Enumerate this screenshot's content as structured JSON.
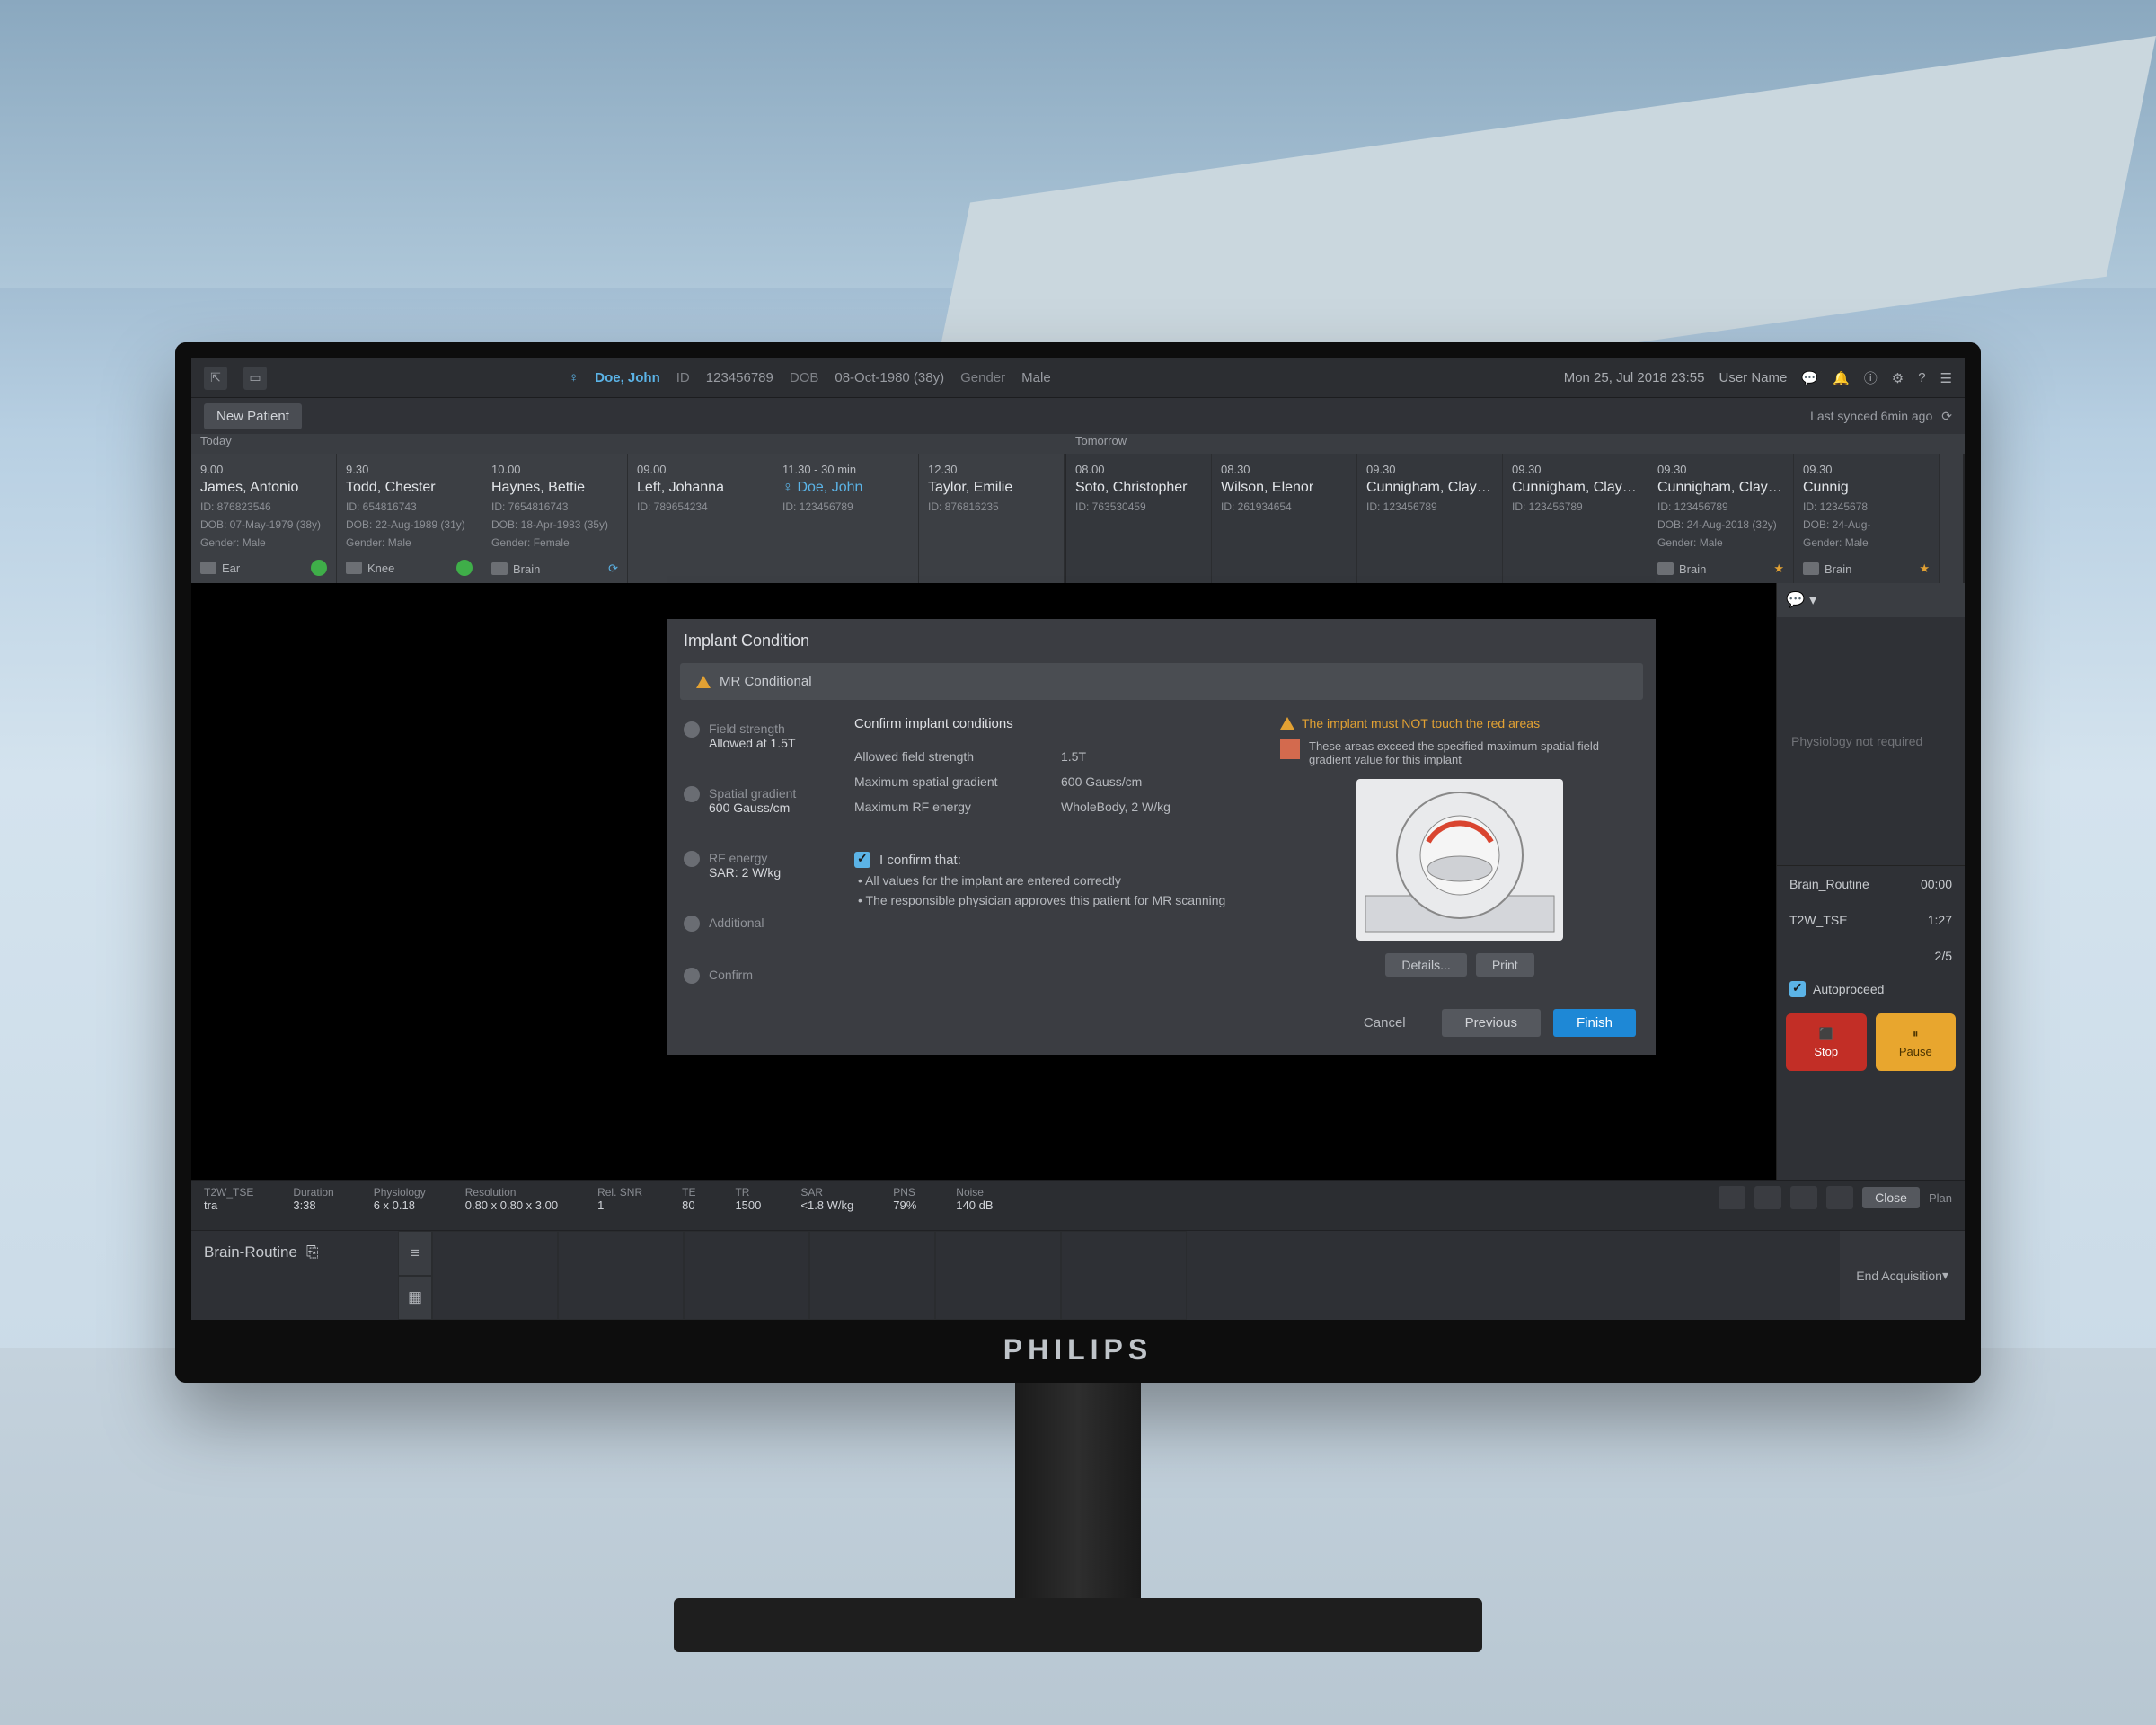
{
  "header": {
    "patient_name": "Doe, John",
    "id_label": "ID",
    "id_value": "123456789",
    "dob_label": "DOB",
    "dob_value": "08-Oct-1980 (38y)",
    "gender_label": "Gender",
    "gender_value": "Male",
    "date_time": "Mon 25, Jul 2018  23:55",
    "user": "User Name"
  },
  "toolbar": {
    "new_patient": "New Patient",
    "last_sync": "Last synced 6min ago"
  },
  "schedule": {
    "today_label": "Today",
    "tomorrow_label": "Tomorrow",
    "today": [
      {
        "time": "9.00",
        "name": "James, Antonio",
        "id": "ID: 876823546",
        "dob": "DOB: 07-May-1979 (38y)",
        "gender": "Gender: Male",
        "region": "Ear",
        "status": "done"
      },
      {
        "time": "9.30",
        "name": "Todd, Chester",
        "id": "ID: 654816743",
        "dob": "DOB: 22-Aug-1989 (31y)",
        "gender": "Gender: Male",
        "region": "Knee",
        "status": "done"
      },
      {
        "time": "10.00",
        "name": "Haynes, Bettie",
        "id": "ID: 7654816743",
        "dob": "DOB: 18-Apr-1983 (35y)",
        "gender": "Gender: Female",
        "region": "Brain",
        "status": "sync"
      },
      {
        "time": "09.00",
        "name": "Left, Johanna",
        "id": "ID: 789654234",
        "dob": "",
        "gender": "",
        "region": "",
        "status": ""
      },
      {
        "time": "11.30 - 30 min",
        "name": "Doe, John",
        "id": "ID: 123456789",
        "dob": "",
        "gender": "",
        "region": "",
        "status": "active"
      },
      {
        "time": "12.30",
        "name": "Taylor, Emilie",
        "id": "ID: 876816235",
        "dob": "",
        "gender": "",
        "region": "",
        "status": ""
      }
    ],
    "tomorrow": [
      {
        "time": "08.00",
        "name": "Soto, Christopher",
        "id": "ID: 763530459",
        "dob": "",
        "gender": "",
        "region": "",
        "status": ""
      },
      {
        "time": "08.30",
        "name": "Wilson, Elenor",
        "id": "ID: 261934654",
        "dob": "",
        "gender": "",
        "region": "",
        "status": ""
      },
      {
        "time": "09.30",
        "name": "Cunnigham, Clayton",
        "id": "ID: 123456789",
        "dob": "",
        "gender": "",
        "region": "",
        "status": ""
      },
      {
        "time": "09.30",
        "name": "Cunnigham, Clayton",
        "id": "ID: 123456789",
        "dob": "",
        "gender": "",
        "region": "",
        "status": ""
      },
      {
        "time": "09.30",
        "name": "Cunnigham, Clayton",
        "id": "ID: 123456789",
        "dob": "DOB: 24-Aug-2018 (32y)",
        "gender": "Gender: Male",
        "region": "Brain",
        "status": "star"
      },
      {
        "time": "09.30",
        "name": "Cunnig",
        "id": "ID: 12345678",
        "dob": "DOB: 24-Aug-",
        "gender": "Gender: Male",
        "region": "Brain",
        "status": "star"
      }
    ]
  },
  "params": {
    "seq": {
      "l": "T2W_TSE",
      "v": "tra"
    },
    "duration": {
      "l": "Duration",
      "v": "3:38"
    },
    "physiology": {
      "l": "Physiology",
      "v": "6 x 0.18"
    },
    "resolution": {
      "l": "Resolution",
      "v": "0.80 x 0.80 x 3.00"
    },
    "relsnr": {
      "l": "Rel. SNR",
      "v": "1"
    },
    "te": {
      "l": "TE",
      "v": "80"
    },
    "tr": {
      "l": "TR",
      "v": "1500"
    },
    "sar": {
      "l": "SAR",
      "v": "<1.8 W/kg"
    },
    "pns": {
      "l": "PNS",
      "v": "79%"
    },
    "noise": {
      "l": "Noise",
      "v": "140 dB"
    },
    "close": "Close",
    "plan": "Plan"
  },
  "footer": {
    "protocol": "Brain-Routine",
    "end_acq": "End Acquisition"
  },
  "rail": {
    "phys": "Physiology not required",
    "seq_name": "Brain_Routine",
    "seq_time": "00:00",
    "seq2_name": "T2W_TSE",
    "seq2_time": "1:27",
    "count": "2/5",
    "auto": "Autoproceed",
    "stop": "Stop",
    "pause": "Pause"
  },
  "dialog": {
    "title": "Implant Condition",
    "badge": "MR Conditional",
    "steps": [
      {
        "t": "Field strength",
        "v": "Allowed at 1.5T"
      },
      {
        "t": "Spatial gradient",
        "v": "600 Gauss/cm"
      },
      {
        "t": "RF energy",
        "v": "SAR: 2 W/kg"
      },
      {
        "t": "Additional",
        "v": ""
      },
      {
        "t": "Confirm",
        "v": ""
      }
    ],
    "heading": "Confirm implant conditions",
    "rows": [
      {
        "k": "Allowed field strength",
        "v": "1.5T"
      },
      {
        "k": "Maximum spatial gradient",
        "v": "600 Gauss/cm"
      },
      {
        "k": "Maximum RF energy",
        "v": "WholeBody, 2 W/kg"
      }
    ],
    "confirm_label": "I confirm that:",
    "bullet1": "• All values for the implant are entered correctly",
    "bullet2": "• The responsible physician approves this patient for MR scanning",
    "warn": "The implant must NOT touch the red areas",
    "info": "These areas exceed the specified maximum spatial field gradient value for this implant",
    "details": "Details...",
    "print": "Print",
    "cancel": "Cancel",
    "prev": "Previous",
    "finish": "Finish"
  },
  "brand": "PHILIPS"
}
